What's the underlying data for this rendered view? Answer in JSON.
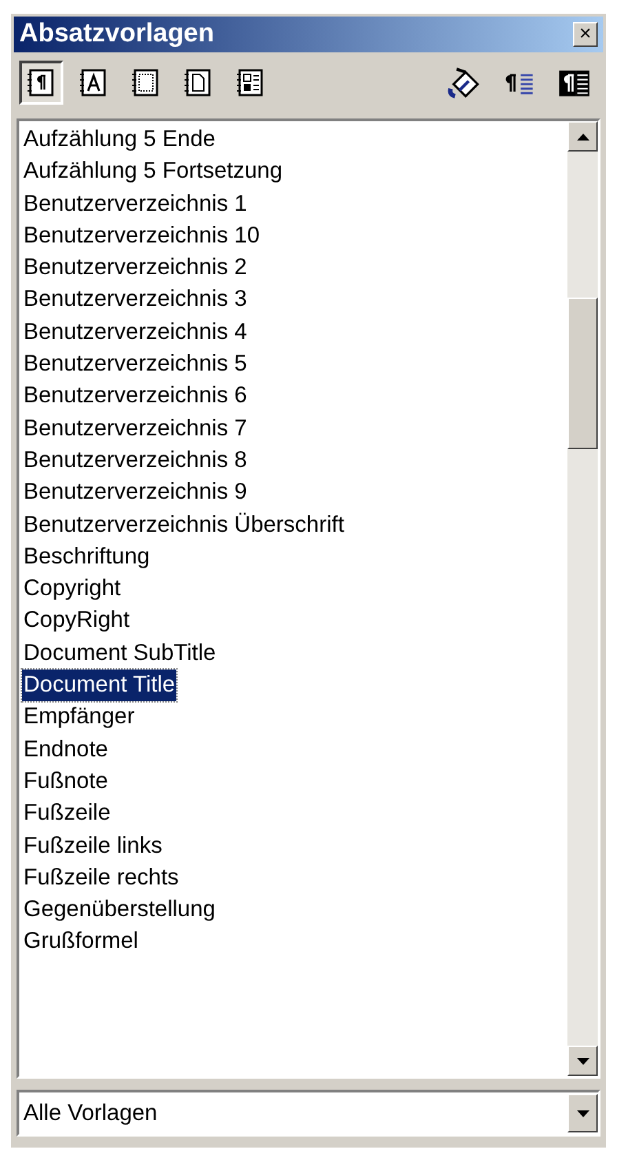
{
  "window": {
    "title": "Absatzvorlagen",
    "close": "×"
  },
  "toolbar": {
    "families": [
      {
        "kind": "paragraph",
        "selected": true
      },
      {
        "kind": "character",
        "selected": false
      },
      {
        "kind": "frame",
        "selected": false
      },
      {
        "kind": "page",
        "selected": false
      },
      {
        "kind": "list",
        "selected": false
      }
    ],
    "actions": [
      {
        "kind": "fill"
      },
      {
        "kind": "new"
      },
      {
        "kind": "update"
      }
    ]
  },
  "styles": [
    {
      "label": "Aufzählung 5 Ende",
      "selected": false
    },
    {
      "label": "Aufzählung 5 Fortsetzung",
      "selected": false
    },
    {
      "label": "Benutzerverzeichnis 1",
      "selected": false
    },
    {
      "label": "Benutzerverzeichnis 10",
      "selected": false
    },
    {
      "label": "Benutzerverzeichnis 2",
      "selected": false
    },
    {
      "label": "Benutzerverzeichnis 3",
      "selected": false
    },
    {
      "label": "Benutzerverzeichnis 4",
      "selected": false
    },
    {
      "label": "Benutzerverzeichnis 5",
      "selected": false
    },
    {
      "label": "Benutzerverzeichnis 6",
      "selected": false
    },
    {
      "label": "Benutzerverzeichnis 7",
      "selected": false
    },
    {
      "label": "Benutzerverzeichnis 8",
      "selected": false
    },
    {
      "label": "Benutzerverzeichnis 9",
      "selected": false
    },
    {
      "label": "Benutzerverzeichnis Überschrift",
      "selected": false
    },
    {
      "label": "Beschriftung",
      "selected": false
    },
    {
      "label": "Copyright",
      "selected": false
    },
    {
      "label": "CopyRight",
      "selected": false
    },
    {
      "label": "Document SubTitle",
      "selected": false
    },
    {
      "label": "Document Title",
      "selected": true
    },
    {
      "label": "Empfänger",
      "selected": false
    },
    {
      "label": "Endnote",
      "selected": false
    },
    {
      "label": "Fußnote",
      "selected": false
    },
    {
      "label": "Fußzeile",
      "selected": false
    },
    {
      "label": "Fußzeile links",
      "selected": false
    },
    {
      "label": "Fußzeile rechts",
      "selected": false
    },
    {
      "label": "Gegenüberstellung",
      "selected": false
    },
    {
      "label": "Grußformel",
      "selected": false
    }
  ],
  "filter": {
    "value": "Alle Vorlagen"
  }
}
